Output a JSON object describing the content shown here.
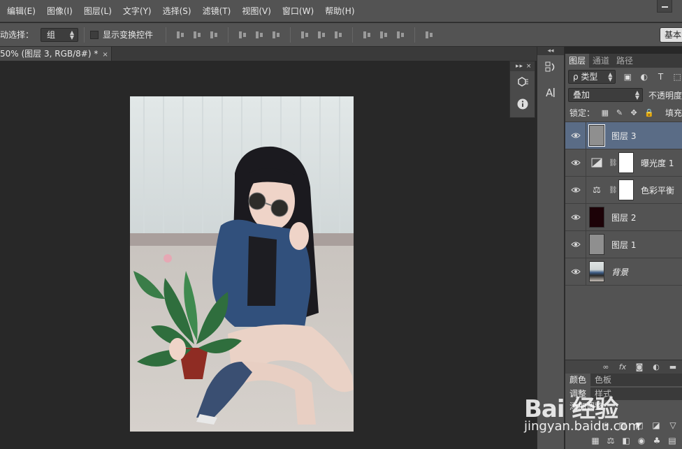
{
  "menu": [
    "编辑(E)",
    "图像(I)",
    "图层(L)",
    "文字(Y)",
    "选择(S)",
    "滤镜(T)",
    "视图(V)",
    "窗口(W)",
    "帮助(H)"
  ],
  "options": {
    "auto_select_label": "自动选择：",
    "auto_select_value": "组",
    "show_transform_label": "显示变换控件",
    "workspace_label": "基本"
  },
  "document": {
    "tab_title": "50% (图层 3, RGB/8#) *",
    "close_glyph": "×"
  },
  "dock": {
    "handle": "▸▸  ×"
  },
  "midcol": {
    "collapse": "◂◂"
  },
  "layers_panel": {
    "tabs": [
      "图层",
      "通道",
      "路径"
    ],
    "filter_label": "ρ 类型",
    "blend_mode": "叠加",
    "opacity_label": "不透明度",
    "lock_label": "锁定：",
    "fill_label": "填充",
    "layers": [
      {
        "name": "图层 3",
        "kind": "gray"
      },
      {
        "name": "曝光度 1",
        "kind": "adjust-exposure"
      },
      {
        "name": "色彩平衡",
        "kind": "adjust-balance"
      },
      {
        "name": "图层 2",
        "kind": "dark"
      },
      {
        "name": "图层 1",
        "kind": "gray"
      },
      {
        "name": "背景",
        "kind": "photo"
      }
    ],
    "footer_icons": [
      "link-icon",
      "fx-icon",
      "mask-icon",
      "adjust-icon",
      "folder-icon"
    ]
  },
  "lower_panel": {
    "tabs": [
      "颜色",
      "色板"
    ],
    "tabs2": [
      "调整",
      "样式"
    ],
    "add_adjust_label": "添加调整"
  },
  "watermark": {
    "logo": "Bai 经验",
    "url": "jingyan.baidu.com"
  }
}
